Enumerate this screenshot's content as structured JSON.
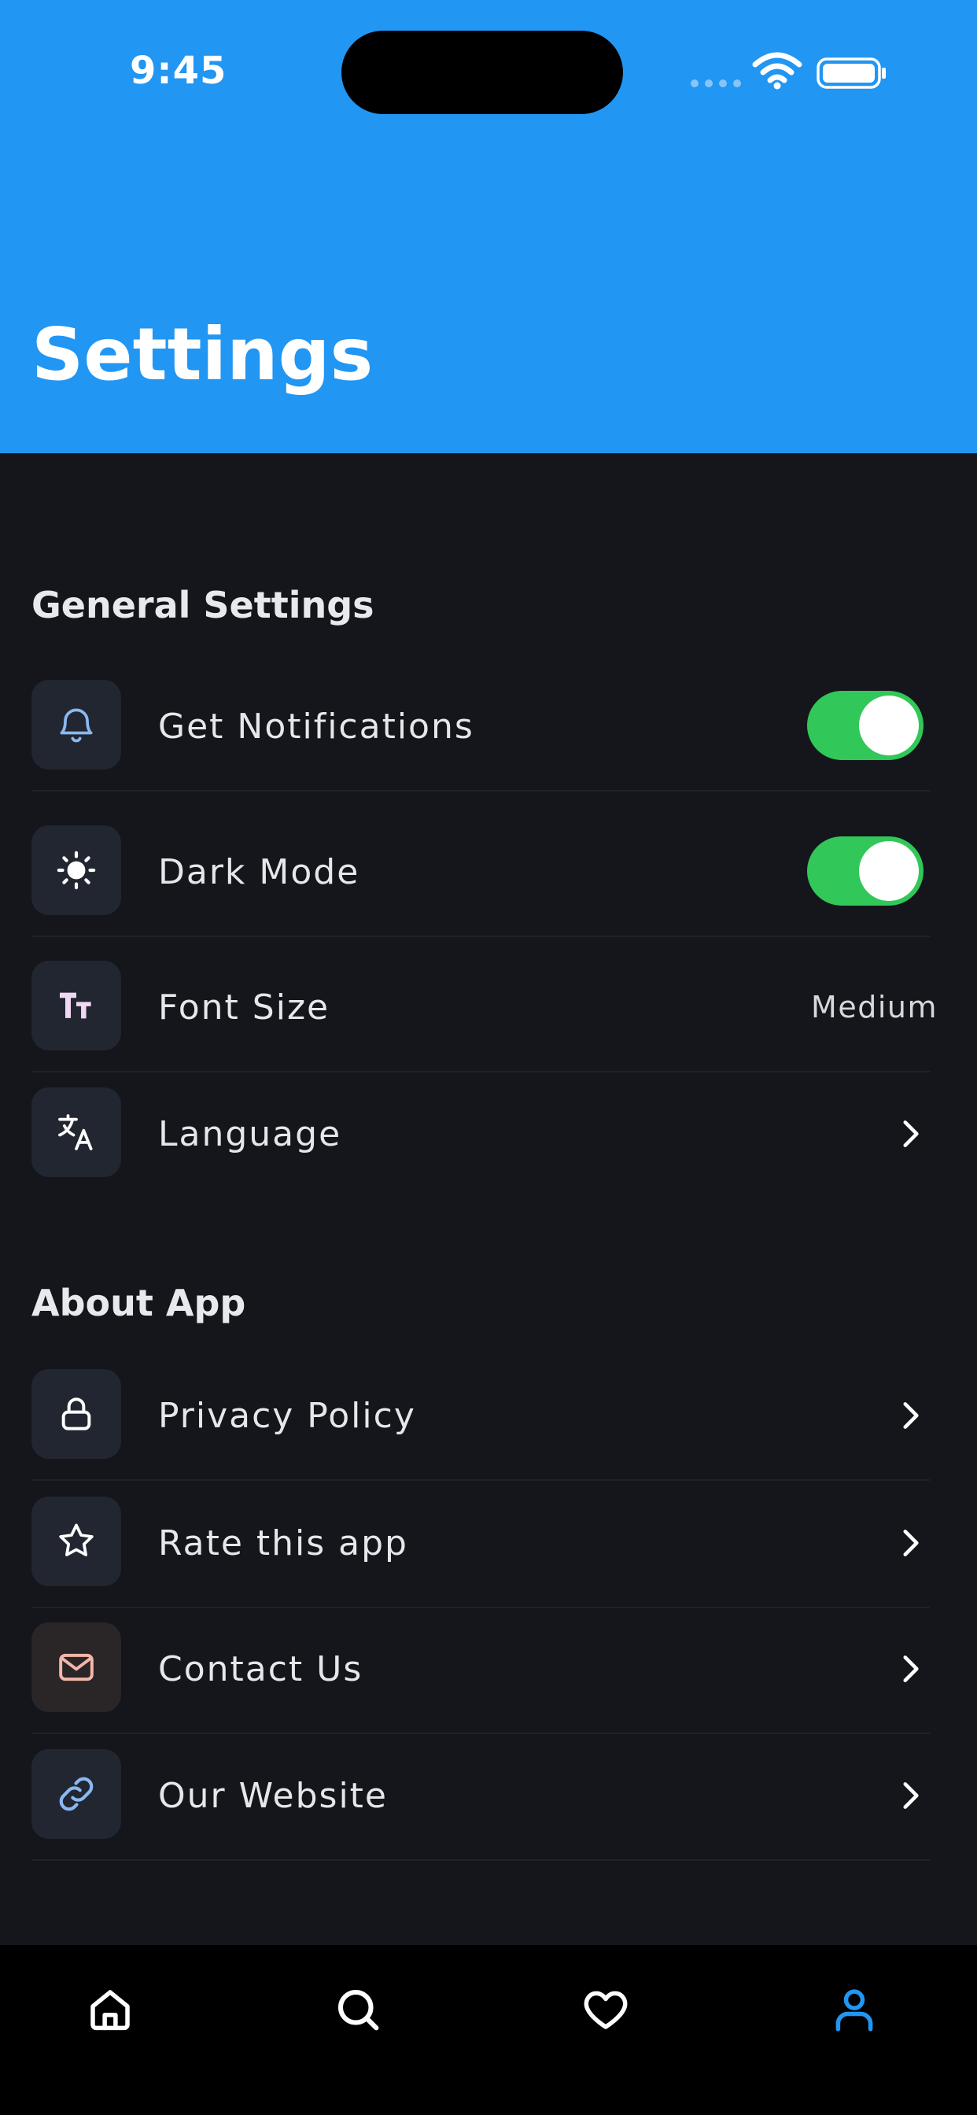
{
  "status_bar": {
    "time": "9:45"
  },
  "header": {
    "title": "Settings",
    "background_color": "#2196f3"
  },
  "sections": {
    "general": {
      "title": "General Settings",
      "items": [
        {
          "label": "Get Notifications",
          "icon": "bell-icon",
          "control": "toggle",
          "toggle_on": true
        },
        {
          "label": "Dark Mode",
          "icon": "sun-icon",
          "control": "toggle",
          "toggle_on": true
        },
        {
          "label": "Font Size",
          "icon": "text-size-icon",
          "control": "value",
          "value": "Medium"
        },
        {
          "label": "Language",
          "icon": "translate-icon",
          "control": "chevron"
        }
      ]
    },
    "about": {
      "title": "About App",
      "items": [
        {
          "label": "Privacy Policy",
          "icon": "lock-icon",
          "control": "chevron"
        },
        {
          "label": "Rate this app",
          "icon": "star-icon",
          "control": "chevron"
        },
        {
          "label": "Contact Us",
          "icon": "mail-icon",
          "control": "chevron"
        },
        {
          "label": "Our Website",
          "icon": "link-icon",
          "control": "chevron"
        }
      ]
    }
  },
  "tab_bar": {
    "tabs": [
      {
        "icon": "home-icon",
        "active": false
      },
      {
        "icon": "search-icon",
        "active": false
      },
      {
        "icon": "heart-icon",
        "active": false
      },
      {
        "icon": "profile-icon",
        "active": true
      }
    ],
    "active_color": "#2196f3"
  },
  "colors": {
    "toggle_on": "#31c759",
    "background": "#14161b",
    "icon_tile": "#222630"
  }
}
